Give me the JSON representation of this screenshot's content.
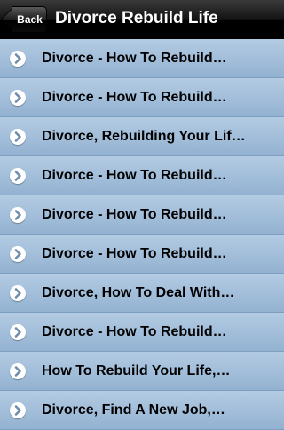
{
  "navbar": {
    "back_label": "Back",
    "title": "Divorce Rebuild Life"
  },
  "list": {
    "items": [
      {
        "label": "Divorce - How To Rebuild…"
      },
      {
        "label": "Divorce - How To Rebuild…"
      },
      {
        "label": "Divorce, Rebuilding Your Lif…"
      },
      {
        "label": "Divorce - How To Rebuild…"
      },
      {
        "label": "Divorce - How To Rebuild…"
      },
      {
        "label": "Divorce - How To Rebuild…"
      },
      {
        "label": "Divorce, How To Deal With…"
      },
      {
        "label": "Divorce - How To Rebuild…"
      },
      {
        "label": "How To Rebuild Your Life,…"
      },
      {
        "label": "Divorce, Find A New Job,…"
      }
    ],
    "chevron_icon": "chevron-right-circle-icon"
  }
}
